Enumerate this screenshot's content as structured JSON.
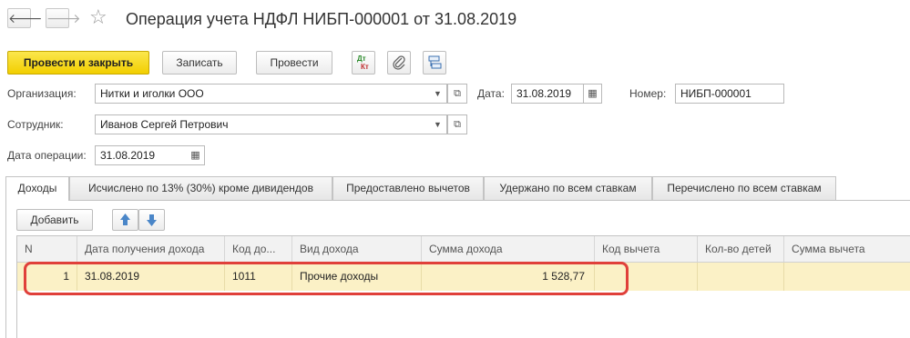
{
  "window": {
    "back_glyph": "🡐",
    "forward_glyph": "🡒",
    "star_glyph": "☆",
    "title": "Операция учета НДФЛ НИБП-000001 от 31.08.2019"
  },
  "toolbar": {
    "post_close_label": "Провести и закрыть",
    "save_label": "Записать",
    "post_label": "Провести",
    "dtkt_top": "Дт",
    "dtkt_bottom": "Кт"
  },
  "form": {
    "org_label": "Организация:",
    "org_value": "Нитки и иголки ООО",
    "date_label": "Дата:",
    "date_value": "31.08.2019",
    "number_label": "Номер:",
    "number_value": "НИБП-000001",
    "employee_label": "Сотрудник:",
    "employee_value": "Иванов Сергей Петрович",
    "op_date_label": "Дата операции:",
    "op_date_value": "31.08.2019"
  },
  "tabs": [
    {
      "label": "Доходы",
      "active": true
    },
    {
      "label": "Исчислено по 13% (30%) кроме дивидендов",
      "active": false
    },
    {
      "label": "Предоставлено вычетов",
      "active": false
    },
    {
      "label": "Удержано по всем ставкам",
      "active": false
    },
    {
      "label": "Перечислено по всем ставкам",
      "active": false
    }
  ],
  "table_toolbar": {
    "add_label": "Добавить"
  },
  "table": {
    "columns": [
      "N",
      "Дата получения дохода",
      "Код до...",
      "Вид дохода",
      "Сумма дохода",
      "Код вычета",
      "Кол-во детей",
      "Сумма вычета"
    ],
    "rows": [
      {
        "n": "1",
        "date": "31.08.2019",
        "code": "1011",
        "kind": "Прочие доходы",
        "amount": "1 528,77",
        "deduction_code": "",
        "children": "",
        "deduction_sum": ""
      }
    ]
  },
  "colors": {
    "primary_button": "#f5d81a",
    "selected_row": "#fbf1c6",
    "highlight_border": "#e0403a"
  }
}
